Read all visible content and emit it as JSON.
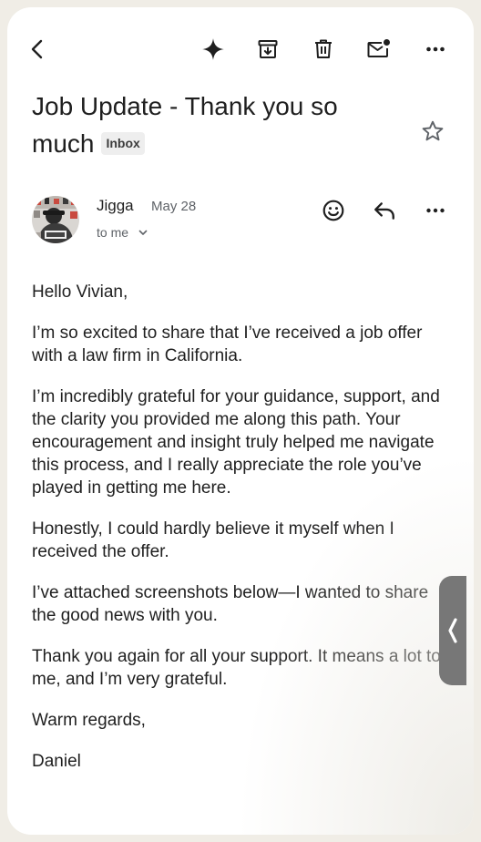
{
  "toolbar": {
    "back_icon": "arrow-left-icon",
    "actions": [
      "sparkle-icon",
      "archive-icon",
      "trash-icon",
      "mark-unread-icon",
      "more-horiz-icon"
    ]
  },
  "email": {
    "subject": "Job Update - Thank you so much",
    "label": "Inbox",
    "starred": false,
    "sender": {
      "name": "Jigga",
      "date": "May 28",
      "recipient": "to me"
    },
    "body": [
      "Hello Vivian,",
      "I’m so excited to share that I’ve received a job offer with a law firm in California.",
      "I’m incredibly grateful for your guidance, support, and the clarity you provided me along this path. Your encouragement and insight truly helped me navigate this process, and I really appreciate the role you’ve played in getting me here.",
      "Honestly, I could hardly believe it myself when I received the offer.",
      "I’ve attached screenshots below—I wanted to share the good news with you.",
      "Thank you again for all your support. It means a lot to me, and I’m very grateful.",
      "Warm regards,",
      "Daniel"
    ]
  },
  "colors": {
    "text": "#1f1f1f",
    "secondary": "#5f6368",
    "badge_bg": "#eeeeee",
    "handle": "#777777"
  }
}
